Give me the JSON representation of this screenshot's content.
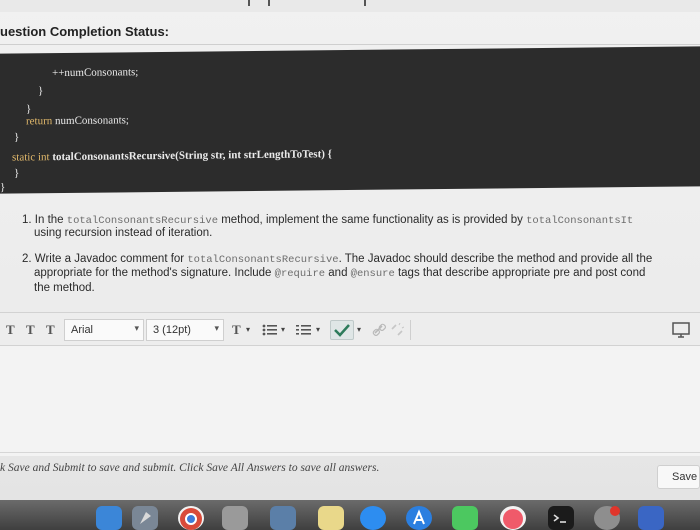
{
  "status": {
    "title": "uestion Completion Status:"
  },
  "code": {
    "lines": [
      {
        "text": "++numConsonants;"
      },
      {
        "text": "}"
      },
      {
        "text": "}"
      },
      {
        "kw": "return",
        "text": " numConsonants;"
      },
      {
        "text": "}"
      },
      {
        "kw": "static int",
        "name": " totalConsonantsRecursive",
        "text": "(String str, int strLengthToTest) {"
      },
      {
        "text": "}"
      },
      {
        "text": "}"
      }
    ]
  },
  "questions": [
    {
      "num": "1.",
      "before": "In the ",
      "code1": "totalConsonantsRecursive",
      "mid": " method, implement the same functionality as is provided by ",
      "code2": "totalConsonantsIt",
      "line2": "using recursion instead of iteration."
    },
    {
      "num": "2.",
      "before": "Write a Javadoc comment for ",
      "code1": "totalConsonantsRecursive",
      "mid": ". The Javadoc should describe the method and provide all the",
      "line2a": "appropriate for the method's signature. Include ",
      "code2": "@require",
      "line2b": " and ",
      "code3": "@ensure",
      "line2c": " tags that describe appropriate pre and post cond",
      "line3": "the method."
    }
  ],
  "toolbar": {
    "t1": "T",
    "t2": "T",
    "t3": "T",
    "font": "Arial",
    "size": "3 (12pt)",
    "textcolor": "T",
    "caret": "▾"
  },
  "footer": {
    "text": "k Save and Submit to save and submit. Click Save All Answers to save all answers.",
    "save": "Save"
  }
}
